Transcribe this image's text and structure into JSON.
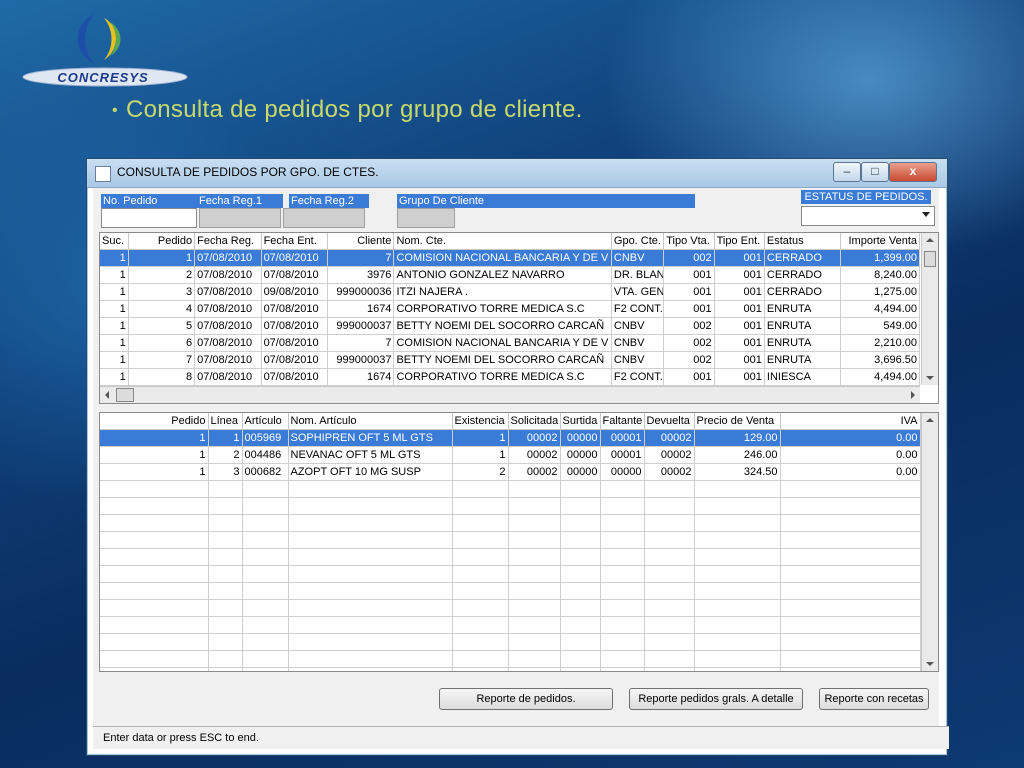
{
  "slide": {
    "logo_text": "CONCRESYS",
    "bullet": "•",
    "title": "Consulta de pedidos por grupo de cliente."
  },
  "window": {
    "title": "CONSULTA DE PEDIDOS POR GPO. DE CTES.",
    "min": "–",
    "max": "□",
    "close": "x"
  },
  "filters": {
    "no_pedido": "No. Pedido",
    "fecha_reg1": "Fecha Reg.1",
    "fecha_reg2": "Fecha Reg.2",
    "grupo_cliente": "Grupo De Cliente",
    "estatus_label": "ESTATUS DE PEDIDOS.",
    "estatus_value": ""
  },
  "orders": {
    "columns": [
      "Suc.",
      "Pedido",
      "Fecha Reg.",
      "Fecha Ent.",
      "Cliente",
      "Nom. Cte.",
      "Gpo. Cte.",
      "Tipo Vta.",
      "Tipo Ent.",
      "Estatus",
      "Importe Venta"
    ],
    "rows": [
      [
        "1",
        "1",
        "07/08/2010",
        "07/08/2010",
        "7",
        "COMISION NACIONAL BANCARIA Y DE V",
        "CNBV",
        "002",
        "001",
        "CERRADO",
        "1,399.00"
      ],
      [
        "1",
        "2",
        "07/08/2010",
        "07/08/2010",
        "3976",
        "ANTONIO GONZALEZ NAVARRO",
        "DR. BLAN",
        "001",
        "001",
        "CERRADO",
        "8,240.00"
      ],
      [
        "1",
        "3",
        "07/08/2010",
        "09/08/2010",
        "999000036",
        "ITZI NAJERA .",
        "VTA. GEN",
        "001",
        "001",
        "CERRADO",
        "1,275.00"
      ],
      [
        "1",
        "4",
        "07/08/2010",
        "07/08/2010",
        "1674",
        "CORPORATIVO TORRE MEDICA S.C",
        "F2 CONT.",
        "001",
        "001",
        "ENRUTA",
        "4,494.00"
      ],
      [
        "1",
        "5",
        "07/08/2010",
        "07/08/2010",
        "999000037",
        "BETTY NOEMI DEL SOCORRO CARCAÑ",
        "CNBV",
        "002",
        "001",
        "ENRUTA",
        "549.00"
      ],
      [
        "1",
        "6",
        "07/08/2010",
        "07/08/2010",
        "7",
        "COMISION NACIONAL BANCARIA Y DE V",
        "CNBV",
        "002",
        "001",
        "ENRUTA",
        "2,210.00"
      ],
      [
        "1",
        "7",
        "07/08/2010",
        "07/08/2010",
        "999000037",
        "BETTY NOEMI DEL SOCORRO CARCAÑ",
        "CNBV",
        "002",
        "001",
        "ENRUTA",
        "3,696.50"
      ],
      [
        "1",
        "8",
        "07/08/2010",
        "07/08/2010",
        "1674",
        "CORPORATIVO TORRE MEDICA S.C",
        "F2 CONT.",
        "001",
        "001",
        "INIESCA",
        "4,494.00"
      ]
    ]
  },
  "items": {
    "columns": [
      "Pedido",
      "Línea",
      "Artículo",
      "Nom. Artículo",
      "Existencia",
      "Solicitada",
      "Surtida",
      "Faltante",
      "Devuelta",
      "Precio de Venta",
      "IVA"
    ],
    "rows": [
      [
        "1",
        "1",
        "005969",
        "SOPHIPREN OFT 5 ML GTS",
        "1",
        "00002",
        "00000",
        "00001",
        "00002",
        "129.00",
        "0.00"
      ],
      [
        "1",
        "2",
        "004486",
        "NEVANAC OFT 5 ML GTS",
        "1",
        "00002",
        "00000",
        "00001",
        "00002",
        "246.00",
        "0.00"
      ],
      [
        "1",
        "3",
        "000682",
        "AZOPT OFT 10 MG SUSP",
        "2",
        "00002",
        "00000",
        "00000",
        "00002",
        "324.50",
        "0.00"
      ]
    ]
  },
  "buttons": {
    "reporte_pedidos": "Reporte de pedidos.",
    "reporte_detalle": "Reporte pedidos grals. A detalle",
    "reporte_recetas": "Reporte con recetas"
  },
  "status_text": "Enter data or press ESC to end."
}
